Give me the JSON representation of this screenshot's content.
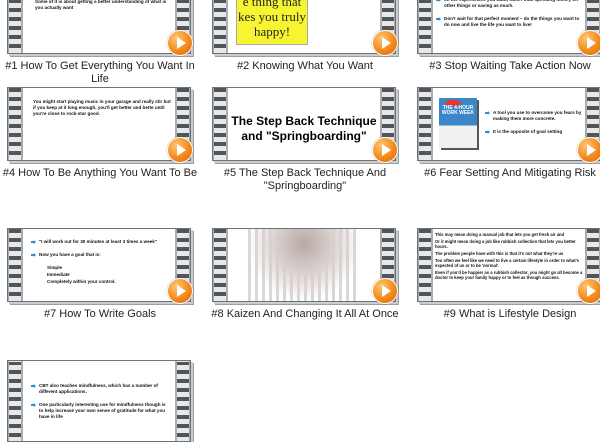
{
  "items": [
    {
      "caption": "#1 How To Get Everything You Want In Life",
      "lines": [
        "Some of it is about getting a better understanding of what is you actually want"
      ]
    },
    {
      "caption": "#2 Knowing What You Want",
      "highlight": "e thing that\nkes you truly\nhappy!"
    },
    {
      "caption": "#3 Stop Waiting Take Action Now",
      "bullets": [
        "on the experiences you want, rather than spending money on other things or saving as much.",
        "Don't wait for that perfect moment – do the things you want to do now and live the life you want to live!"
      ]
    },
    {
      "caption": "#4 How To Be Anything You Want To Be",
      "lines": [
        "You might start playing music in your garage and really stir but if you keep at it long enough, you'll get better and bette until you're close to rock-star good."
      ]
    },
    {
      "caption": "#5 The Step Back Technique And \"Springboarding\"",
      "title": "The Step Back Technique and \"Springboarding\""
    },
    {
      "caption": "#6 Fear Setting And Mitigating Risk",
      "book_title": "THE 4-HOUR WORK WEEK",
      "bullets": [
        "A tool you use to overcome you fears by making them more concrete.",
        "It is the opposite of goal setting"
      ]
    },
    {
      "caption": "#7 How To Write Goals",
      "bullets": [
        "\"I will work out for 30 minutes at least 3 times a week\"",
        "Now you have a goal that is:"
      ],
      "sub_bullets": [
        "Simple",
        "Immediate",
        "Completely within your control."
      ]
    },
    {
      "caption": "#8 Kaizen And Changing It All At Once"
    },
    {
      "caption": "#9 What is Lifestyle Design",
      "lines": [
        "This may mean doing a manual job that lets you get fresh air and",
        "Or it might mean doing a job like rubbish collection that lets you better hours.",
        "The problem people have with this is that it's not what they're us",
        "Too often we feel like we need to live a certain lifestyle in order to what's expected of us or to be 'normal'.",
        "Even if you'd be happier as a rubbish collector, you might go all become a doctor to keep your family happy or to feel as though success."
      ]
    },
    {
      "caption": "",
      "bullets": [
        "CBT also teaches mindfulness, which has a number of different applications.",
        "One particularly interesting use for mindfulness though is to help increase your own sense of gratitude for what you have in life"
      ]
    }
  ]
}
